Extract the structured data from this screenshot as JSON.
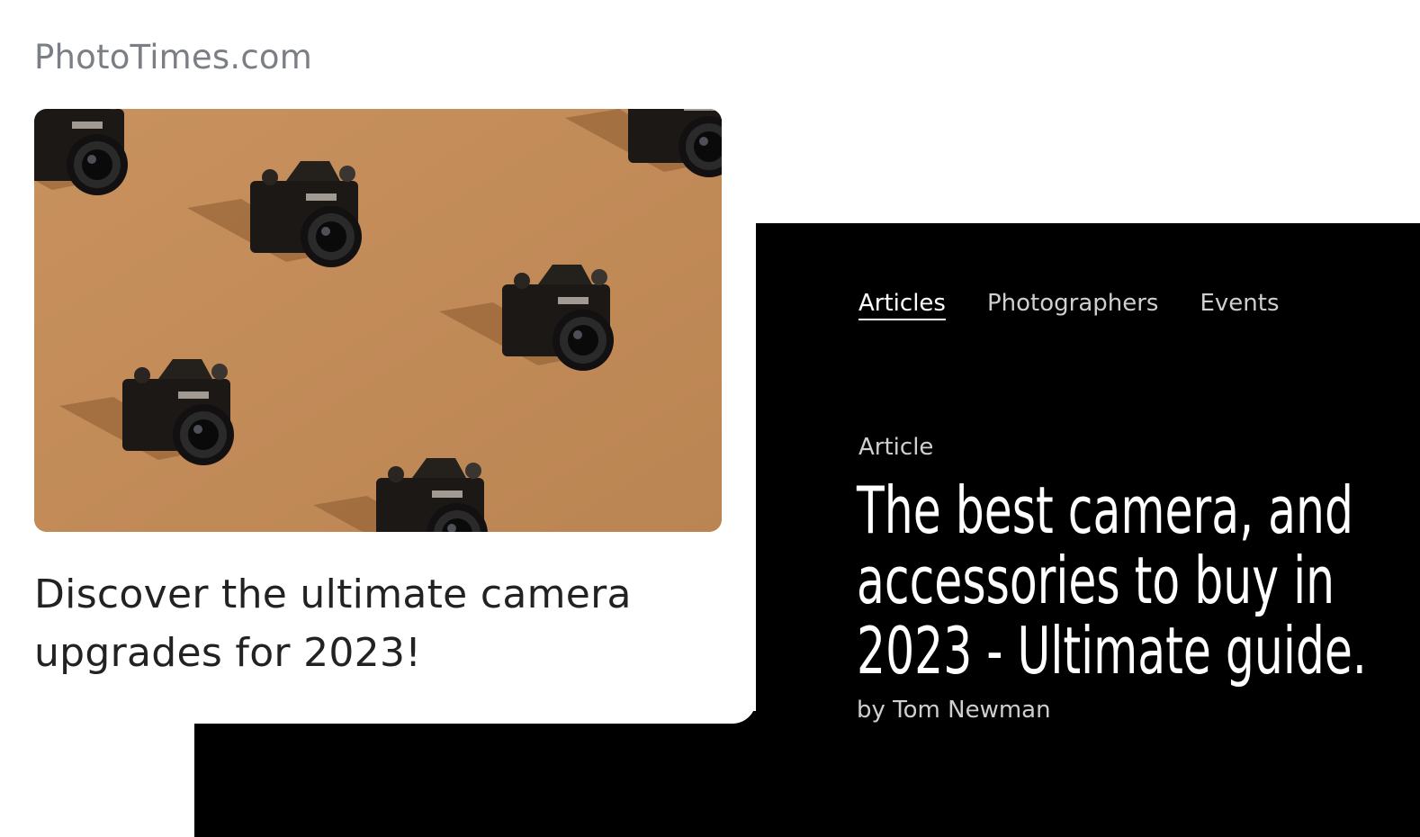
{
  "site": {
    "logo": "PhotoTimes.com"
  },
  "feature": {
    "image_alt": "cameras-on-orange-background",
    "headline_line1": "Discover the ultimate camera",
    "headline_line2": "upgrades for 2023!"
  },
  "nav": {
    "items": [
      {
        "label": "Articles",
        "active": true
      },
      {
        "label": "Photographers",
        "active": false
      },
      {
        "label": "Events",
        "active": false
      }
    ]
  },
  "article": {
    "kicker": "Article",
    "title_line1": "The best camera, and",
    "title_line2": "accessories to buy in",
    "title_line3": "2023 - Ultimate guide.",
    "byline": "by Tom Newman"
  },
  "colors": {
    "background": "#ffffff",
    "dark_panel": "#000000",
    "hero_bg": "#c28a58",
    "logo_text": "#7b7e84"
  }
}
